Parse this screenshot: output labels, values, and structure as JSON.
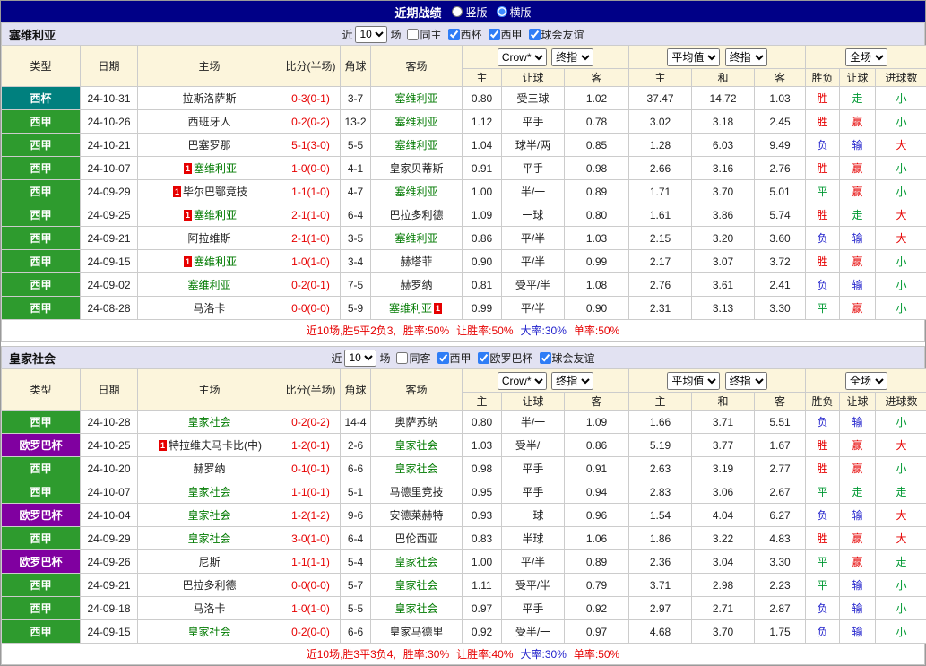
{
  "topbar": {
    "title": "近期战绩",
    "radios": [
      {
        "label": "竖版",
        "selected": false
      },
      {
        "label": "横版",
        "selected": true
      }
    ]
  },
  "ui": {
    "near_label": "近",
    "games_label": "场"
  },
  "columns": {
    "left": [
      "类型",
      "日期",
      "主场",
      "比分(半场)",
      "角球",
      "客场"
    ],
    "sub": [
      "主",
      "让球",
      "客",
      "主",
      "和",
      "客",
      "胜负",
      "让球",
      "进球数"
    ]
  },
  "odds_dropdowns": {
    "asian_source": "Crow*",
    "asian_final": "终指",
    "euro_source": "平均值",
    "euro_final": "终指",
    "full_time": "全场"
  },
  "type_colors": {
    "西杯": "#00807E",
    "西甲": "#2E9B2E",
    "欧罗巴杯": "#8000A0"
  },
  "result_colors": {
    "w": "#E60000",
    "d": "#009933",
    "l": "#2222CC"
  },
  "sections": [
    {
      "team": "塞维利亚",
      "filter": {
        "count": "10",
        "same_label": "同主",
        "same_checked": false,
        "leagues": [
          {
            "label": "西杯",
            "checked": true
          },
          {
            "label": "西甲",
            "checked": true
          },
          {
            "label": "球会友谊",
            "checked": true
          }
        ]
      },
      "rows": [
        {
          "type": "西杯",
          "date": "24-10-31",
          "home": {
            "name": "拉斯洛萨斯",
            "focal": false
          },
          "score": "0-3(0-1)",
          "corner": "3-7",
          "away": {
            "name": "塞维利亚",
            "focal": true
          },
          "asian": [
            "0.80",
            "受三球",
            "1.02"
          ],
          "euro": [
            "37.47",
            "14.72",
            "1.03"
          ],
          "results": [
            [
              "胜",
              "w"
            ],
            [
              "走",
              "d"
            ],
            [
              "小",
              "d"
            ]
          ]
        },
        {
          "type": "西甲",
          "date": "24-10-26",
          "home": {
            "name": "西班牙人",
            "focal": false
          },
          "score": "0-2(0-2)",
          "corner": "13-2",
          "away": {
            "name": "塞维利亚",
            "focal": true
          },
          "asian": [
            "1.12",
            "平手",
            "0.78"
          ],
          "euro": [
            "3.02",
            "3.18",
            "2.45"
          ],
          "results": [
            [
              "胜",
              "w"
            ],
            [
              "赢",
              "w"
            ],
            [
              "小",
              "d"
            ]
          ]
        },
        {
          "type": "西甲",
          "date": "24-10-21",
          "home": {
            "name": "巴塞罗那",
            "focal": false
          },
          "score": "5-1(3-0)",
          "corner": "5-5",
          "away": {
            "name": "塞维利亚",
            "focal": true
          },
          "asian": [
            "1.04",
            "球半/两",
            "0.85"
          ],
          "euro": [
            "1.28",
            "6.03",
            "9.49"
          ],
          "results": [
            [
              "负",
              "l"
            ],
            [
              "输",
              "l"
            ],
            [
              "大",
              "w"
            ]
          ]
        },
        {
          "type": "西甲",
          "date": "24-10-07",
          "home": {
            "name": "塞维利亚",
            "focal": true,
            "badge_before": "1"
          },
          "score": "1-0(0-0)",
          "corner": "4-1",
          "away": {
            "name": "皇家贝蒂斯",
            "focal": false
          },
          "asian": [
            "0.91",
            "平手",
            "0.98"
          ],
          "euro": [
            "2.66",
            "3.16",
            "2.76"
          ],
          "results": [
            [
              "胜",
              "w"
            ],
            [
              "赢",
              "w"
            ],
            [
              "小",
              "d"
            ]
          ]
        },
        {
          "type": "西甲",
          "date": "24-09-29",
          "home": {
            "name": "毕尔巴鄂竞技",
            "focal": false,
            "badge_before": "1"
          },
          "score": "1-1(1-0)",
          "corner": "4-7",
          "away": {
            "name": "塞维利亚",
            "focal": true
          },
          "asian": [
            "1.00",
            "半/一",
            "0.89"
          ],
          "euro": [
            "1.71",
            "3.70",
            "5.01"
          ],
          "results": [
            [
              "平",
              "d"
            ],
            [
              "赢",
              "w"
            ],
            [
              "小",
              "d"
            ]
          ]
        },
        {
          "type": "西甲",
          "date": "24-09-25",
          "home": {
            "name": "塞维利亚",
            "focal": true,
            "badge_before": "1"
          },
          "score": "2-1(1-0)",
          "corner": "6-4",
          "away": {
            "name": "巴拉多利德",
            "focal": false
          },
          "asian": [
            "1.09",
            "一球",
            "0.80"
          ],
          "euro": [
            "1.61",
            "3.86",
            "5.74"
          ],
          "results": [
            [
              "胜",
              "w"
            ],
            [
              "走",
              "d"
            ],
            [
              "大",
              "w"
            ]
          ]
        },
        {
          "type": "西甲",
          "date": "24-09-21",
          "home": {
            "name": "阿拉维斯",
            "focal": false
          },
          "score": "2-1(1-0)",
          "corner": "3-5",
          "away": {
            "name": "塞维利亚",
            "focal": true
          },
          "asian": [
            "0.86",
            "平/半",
            "1.03"
          ],
          "euro": [
            "2.15",
            "3.20",
            "3.60"
          ],
          "results": [
            [
              "负",
              "l"
            ],
            [
              "输",
              "l"
            ],
            [
              "大",
              "w"
            ]
          ]
        },
        {
          "type": "西甲",
          "date": "24-09-15",
          "home": {
            "name": "塞维利亚",
            "focal": true,
            "badge_before": "1"
          },
          "score": "1-0(1-0)",
          "corner": "3-4",
          "away": {
            "name": "赫塔菲",
            "focal": false
          },
          "asian": [
            "0.90",
            "平/半",
            "0.99"
          ],
          "euro": [
            "2.17",
            "3.07",
            "3.72"
          ],
          "results": [
            [
              "胜",
              "w"
            ],
            [
              "赢",
              "w"
            ],
            [
              "小",
              "d"
            ]
          ]
        },
        {
          "type": "西甲",
          "date": "24-09-02",
          "home": {
            "name": "塞维利亚",
            "focal": true
          },
          "score": "0-2(0-1)",
          "corner": "7-5",
          "away": {
            "name": "赫罗纳",
            "focal": false
          },
          "asian": [
            "0.81",
            "受平/半",
            "1.08"
          ],
          "euro": [
            "2.76",
            "3.61",
            "2.41"
          ],
          "results": [
            [
              "负",
              "l"
            ],
            [
              "输",
              "l"
            ],
            [
              "小",
              "d"
            ]
          ]
        },
        {
          "type": "西甲",
          "date": "24-08-28",
          "home": {
            "name": "马洛卡",
            "focal": false
          },
          "score": "0-0(0-0)",
          "corner": "5-9",
          "away": {
            "name": "塞维利亚",
            "focal": true,
            "badge_after": "1"
          },
          "asian": [
            "0.99",
            "平/半",
            "0.90"
          ],
          "euro": [
            "2.31",
            "3.13",
            "3.30"
          ],
          "results": [
            [
              "平",
              "d"
            ],
            [
              "赢",
              "w"
            ],
            [
              "小",
              "d"
            ]
          ]
        }
      ],
      "summary": [
        {
          "text": "近10场,胜5平2负3,",
          "c": "w"
        },
        {
          "text": "胜率:50%",
          "c": "w"
        },
        {
          "text": "让胜率:50%",
          "c": "w"
        },
        {
          "text": "大率:30%",
          "c": "l"
        },
        {
          "text": "单率:50%",
          "c": "w"
        }
      ]
    },
    {
      "team": "皇家社会",
      "filter": {
        "count": "10",
        "same_label": "同客",
        "same_checked": false,
        "leagues": [
          {
            "label": "西甲",
            "checked": true
          },
          {
            "label": "欧罗巴杯",
            "checked": true
          },
          {
            "label": "球会友谊",
            "checked": true
          }
        ]
      },
      "rows": [
        {
          "type": "西甲",
          "date": "24-10-28",
          "home": {
            "name": "皇家社会",
            "focal": true
          },
          "score": "0-2(0-2)",
          "corner": "14-4",
          "away": {
            "name": "奥萨苏纳",
            "focal": false
          },
          "asian": [
            "0.80",
            "半/一",
            "1.09"
          ],
          "euro": [
            "1.66",
            "3.71",
            "5.51"
          ],
          "results": [
            [
              "负",
              "l"
            ],
            [
              "输",
              "l"
            ],
            [
              "小",
              "d"
            ]
          ]
        },
        {
          "type": "欧罗巴杯",
          "date": "24-10-25",
          "home": {
            "name": "特拉维夫马卡比(中)",
            "focal": false,
            "badge_before": "1"
          },
          "score": "1-2(0-1)",
          "corner": "2-6",
          "away": {
            "name": "皇家社会",
            "focal": true
          },
          "asian": [
            "1.03",
            "受半/一",
            "0.86"
          ],
          "euro": [
            "5.19",
            "3.77",
            "1.67"
          ],
          "results": [
            [
              "胜",
              "w"
            ],
            [
              "赢",
              "w"
            ],
            [
              "大",
              "w"
            ]
          ]
        },
        {
          "type": "西甲",
          "date": "24-10-20",
          "home": {
            "name": "赫罗纳",
            "focal": false
          },
          "score": "0-1(0-1)",
          "corner": "6-6",
          "away": {
            "name": "皇家社会",
            "focal": true
          },
          "asian": [
            "0.98",
            "平手",
            "0.91"
          ],
          "euro": [
            "2.63",
            "3.19",
            "2.77"
          ],
          "results": [
            [
              "胜",
              "w"
            ],
            [
              "赢",
              "w"
            ],
            [
              "小",
              "d"
            ]
          ]
        },
        {
          "type": "西甲",
          "date": "24-10-07",
          "home": {
            "name": "皇家社会",
            "focal": true
          },
          "score": "1-1(0-1)",
          "corner": "5-1",
          "away": {
            "name": "马德里竞技",
            "focal": false
          },
          "asian": [
            "0.95",
            "平手",
            "0.94"
          ],
          "euro": [
            "2.83",
            "3.06",
            "2.67"
          ],
          "results": [
            [
              "平",
              "d"
            ],
            [
              "走",
              "d"
            ],
            [
              "走",
              "d"
            ]
          ]
        },
        {
          "type": "欧罗巴杯",
          "date": "24-10-04",
          "home": {
            "name": "皇家社会",
            "focal": true
          },
          "score": "1-2(1-2)",
          "corner": "9-6",
          "away": {
            "name": "安德莱赫特",
            "focal": false
          },
          "asian": [
            "0.93",
            "一球",
            "0.96"
          ],
          "euro": [
            "1.54",
            "4.04",
            "6.27"
          ],
          "results": [
            [
              "负",
              "l"
            ],
            [
              "输",
              "l"
            ],
            [
              "大",
              "w"
            ]
          ]
        },
        {
          "type": "西甲",
          "date": "24-09-29",
          "home": {
            "name": "皇家社会",
            "focal": true
          },
          "score": "3-0(1-0)",
          "corner": "6-4",
          "away": {
            "name": "巴伦西亚",
            "focal": false
          },
          "asian": [
            "0.83",
            "半球",
            "1.06"
          ],
          "euro": [
            "1.86",
            "3.22",
            "4.83"
          ],
          "results": [
            [
              "胜",
              "w"
            ],
            [
              "赢",
              "w"
            ],
            [
              "大",
              "w"
            ]
          ]
        },
        {
          "type": "欧罗巴杯",
          "date": "24-09-26",
          "home": {
            "name": "尼斯",
            "focal": false
          },
          "score": "1-1(1-1)",
          "corner": "5-4",
          "away": {
            "name": "皇家社会",
            "focal": true
          },
          "asian": [
            "1.00",
            "平/半",
            "0.89"
          ],
          "euro": [
            "2.36",
            "3.04",
            "3.30"
          ],
          "results": [
            [
              "平",
              "d"
            ],
            [
              "赢",
              "w"
            ],
            [
              "走",
              "d"
            ]
          ]
        },
        {
          "type": "西甲",
          "date": "24-09-21",
          "home": {
            "name": "巴拉多利德",
            "focal": false
          },
          "score": "0-0(0-0)",
          "corner": "5-7",
          "away": {
            "name": "皇家社会",
            "focal": true
          },
          "asian": [
            "1.11",
            "受平/半",
            "0.79"
          ],
          "euro": [
            "3.71",
            "2.98",
            "2.23"
          ],
          "results": [
            [
              "平",
              "d"
            ],
            [
              "输",
              "l"
            ],
            [
              "小",
              "d"
            ]
          ]
        },
        {
          "type": "西甲",
          "date": "24-09-18",
          "home": {
            "name": "马洛卡",
            "focal": false
          },
          "score": "1-0(1-0)",
          "corner": "5-5",
          "away": {
            "name": "皇家社会",
            "focal": true
          },
          "asian": [
            "0.97",
            "平手",
            "0.92"
          ],
          "euro": [
            "2.97",
            "2.71",
            "2.87"
          ],
          "results": [
            [
              "负",
              "l"
            ],
            [
              "输",
              "l"
            ],
            [
              "小",
              "d"
            ]
          ]
        },
        {
          "type": "西甲",
          "date": "24-09-15",
          "home": {
            "name": "皇家社会",
            "focal": true
          },
          "score": "0-2(0-0)",
          "corner": "6-6",
          "away": {
            "name": "皇家马德里",
            "focal": false
          },
          "asian": [
            "0.92",
            "受半/一",
            "0.97"
          ],
          "euro": [
            "4.68",
            "3.70",
            "1.75"
          ],
          "results": [
            [
              "负",
              "l"
            ],
            [
              "输",
              "l"
            ],
            [
              "小",
              "d"
            ]
          ]
        }
      ],
      "summary": [
        {
          "text": "近10场,胜3平3负4,",
          "c": "w"
        },
        {
          "text": "胜率:30%",
          "c": "w"
        },
        {
          "text": "让胜率:40%",
          "c": "w"
        },
        {
          "text": "大率:30%",
          "c": "l"
        },
        {
          "text": "单率:50%",
          "c": "w"
        }
      ]
    }
  ]
}
